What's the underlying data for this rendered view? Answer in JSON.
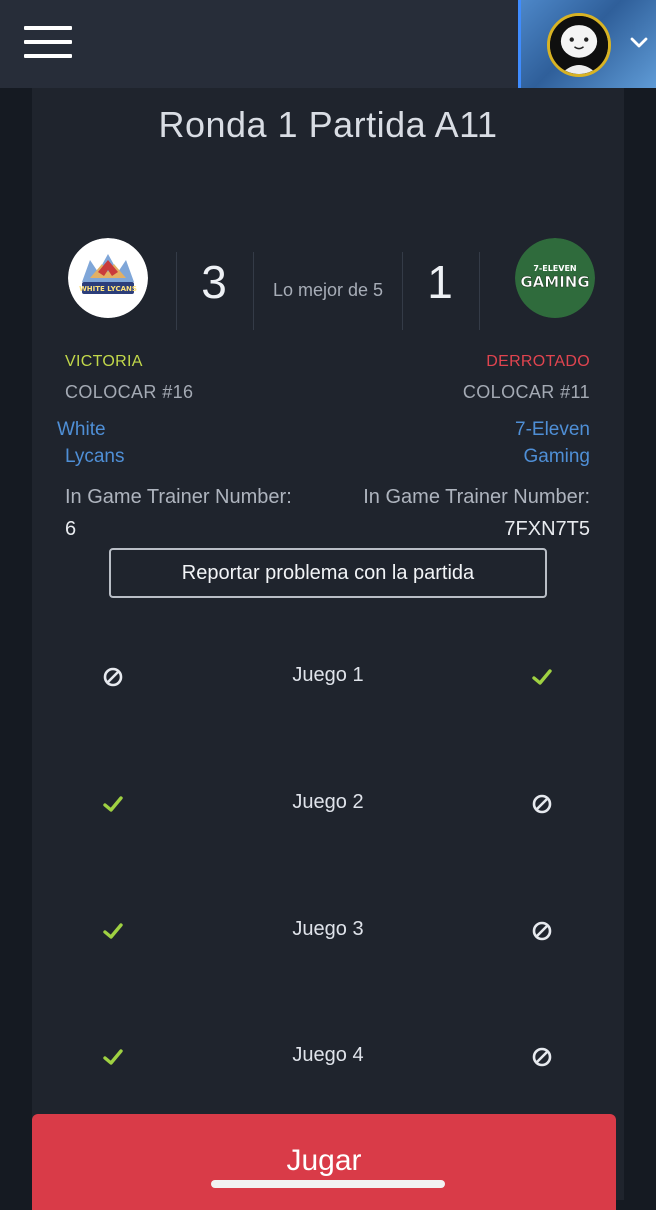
{
  "header": {
    "menu_icon": "hamburger-menu-icon",
    "user_avatar_icon": "user-avatar-icon",
    "dropdown_icon": "chevron-down-icon"
  },
  "match": {
    "title": "Ronda 1 Partida A11",
    "best_of": "Lo mejor de 5",
    "team1": {
      "logo_text": "WHITE LYCANS",
      "score": "3",
      "result": "VICTORIA",
      "seed": "COLOCAR #16",
      "name_line1": "White",
      "name_line2": "Lycans",
      "trainer_label": "In Game Trainer Number:",
      "trainer_value": "6"
    },
    "team2": {
      "logo_text_top": "7-ELEVEN",
      "logo_text_main": "GAMING",
      "score": "1",
      "result": "DERROTADO",
      "seed": "COLOCAR #11",
      "name_line1": "7-Eleven",
      "name_line2": "Gaming",
      "trainer_label": "In Game Trainer Number:",
      "trainer_value": "7FXN7T5"
    },
    "report_button": "Reportar problema con la partida",
    "games": [
      {
        "label": "Juego 1",
        "team1": "lost",
        "team2": "won"
      },
      {
        "label": "Juego 2",
        "team1": "won",
        "team2": "lost"
      },
      {
        "label": "Juego 3",
        "team1": "won",
        "team2": "lost"
      },
      {
        "label": "Juego 4",
        "team1": "won",
        "team2": "lost"
      }
    ],
    "play_button": "Jugar"
  },
  "colors": {
    "victory": "#c2d84a",
    "defeat": "#e0444f",
    "link": "#4f8fd6",
    "check": "#9fd142",
    "play_button": "#d93b48"
  }
}
